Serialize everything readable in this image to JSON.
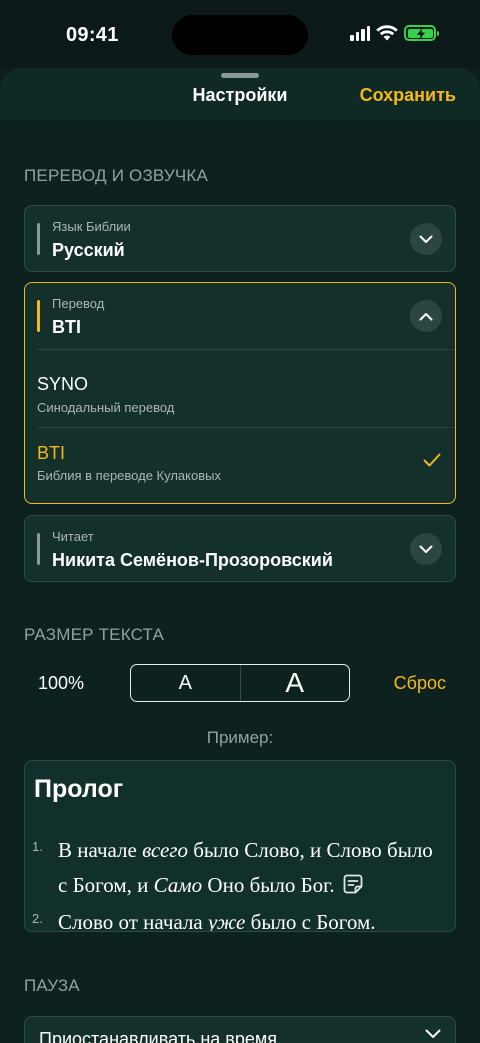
{
  "status_bar": {
    "time": "09:41"
  },
  "nav": {
    "title": "Настройки",
    "save_label": "Сохранить"
  },
  "sections": {
    "translation_title": "ПЕРЕВОД И ОЗВУЧКА",
    "text_size_title": "РАЗМЕР ТЕКСТА",
    "pause_title": "ПАУЗА"
  },
  "bible_language": {
    "label": "Язык Библии",
    "value": "Русский"
  },
  "translation": {
    "label": "Перевод",
    "value": "BTI",
    "options": [
      {
        "title": "SYNO",
        "subtitle": "Синодальный перевод",
        "selected": false
      },
      {
        "title": "BTI",
        "subtitle": "Библия в переводе Кулаковых",
        "selected": true
      }
    ]
  },
  "reader": {
    "label": "Читает",
    "value": "Никита Семёнов-Прозоровский"
  },
  "text_size": {
    "percent": "100%",
    "smaller_label": "A",
    "larger_label": "A",
    "reset_label": "Сброс"
  },
  "example": {
    "label": "Пример:",
    "title": "Пролог",
    "verses": [
      {
        "num": "1.",
        "lines": [
          [
            "В начале ",
            "всего",
            " было Слово, и Слово было"
          ],
          [
            "с Богом, и ",
            "Само",
            " Оно было Бог."
          ]
        ]
      },
      {
        "num": "2.",
        "lines": [
          [
            "Слово от начала ",
            "уже",
            " было с Богом."
          ]
        ]
      }
    ]
  },
  "pause": {
    "value": "Приостанавливать на время"
  },
  "icons": [
    "signal-icon",
    "wifi-icon",
    "battery-icon",
    "chevron-down-icon",
    "chevron-up-icon",
    "checkmark-icon",
    "note-icon"
  ],
  "colors": {
    "accent": "#f4b81c",
    "background": "#0d221e",
    "card": "#13302b",
    "battery": "#37d04a"
  }
}
